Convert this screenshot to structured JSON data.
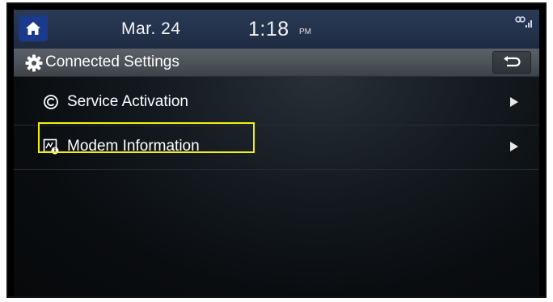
{
  "status_bar": {
    "date": "Mar. 24",
    "time": "1:18",
    "ampm": "PM",
    "home_icon": "home-icon",
    "signal_icon": "connected-signal-icon"
  },
  "header": {
    "title": "Connected Settings",
    "icon": "gear-icon",
    "back_icon": "back-arrow-icon"
  },
  "menu": {
    "items": [
      {
        "label": "Service Activation",
        "icon": "service-activation-icon",
        "chevron": "chevron-right-icon"
      },
      {
        "label": "Modem Information",
        "icon": "modem-info-icon",
        "chevron": "chevron-right-icon"
      }
    ]
  },
  "colors": {
    "status_bar": "#23324b",
    "home_button": "#1b3a8c",
    "header_bar": "#4b5258",
    "highlight": "#f2f20a",
    "text": "#ffffff"
  }
}
